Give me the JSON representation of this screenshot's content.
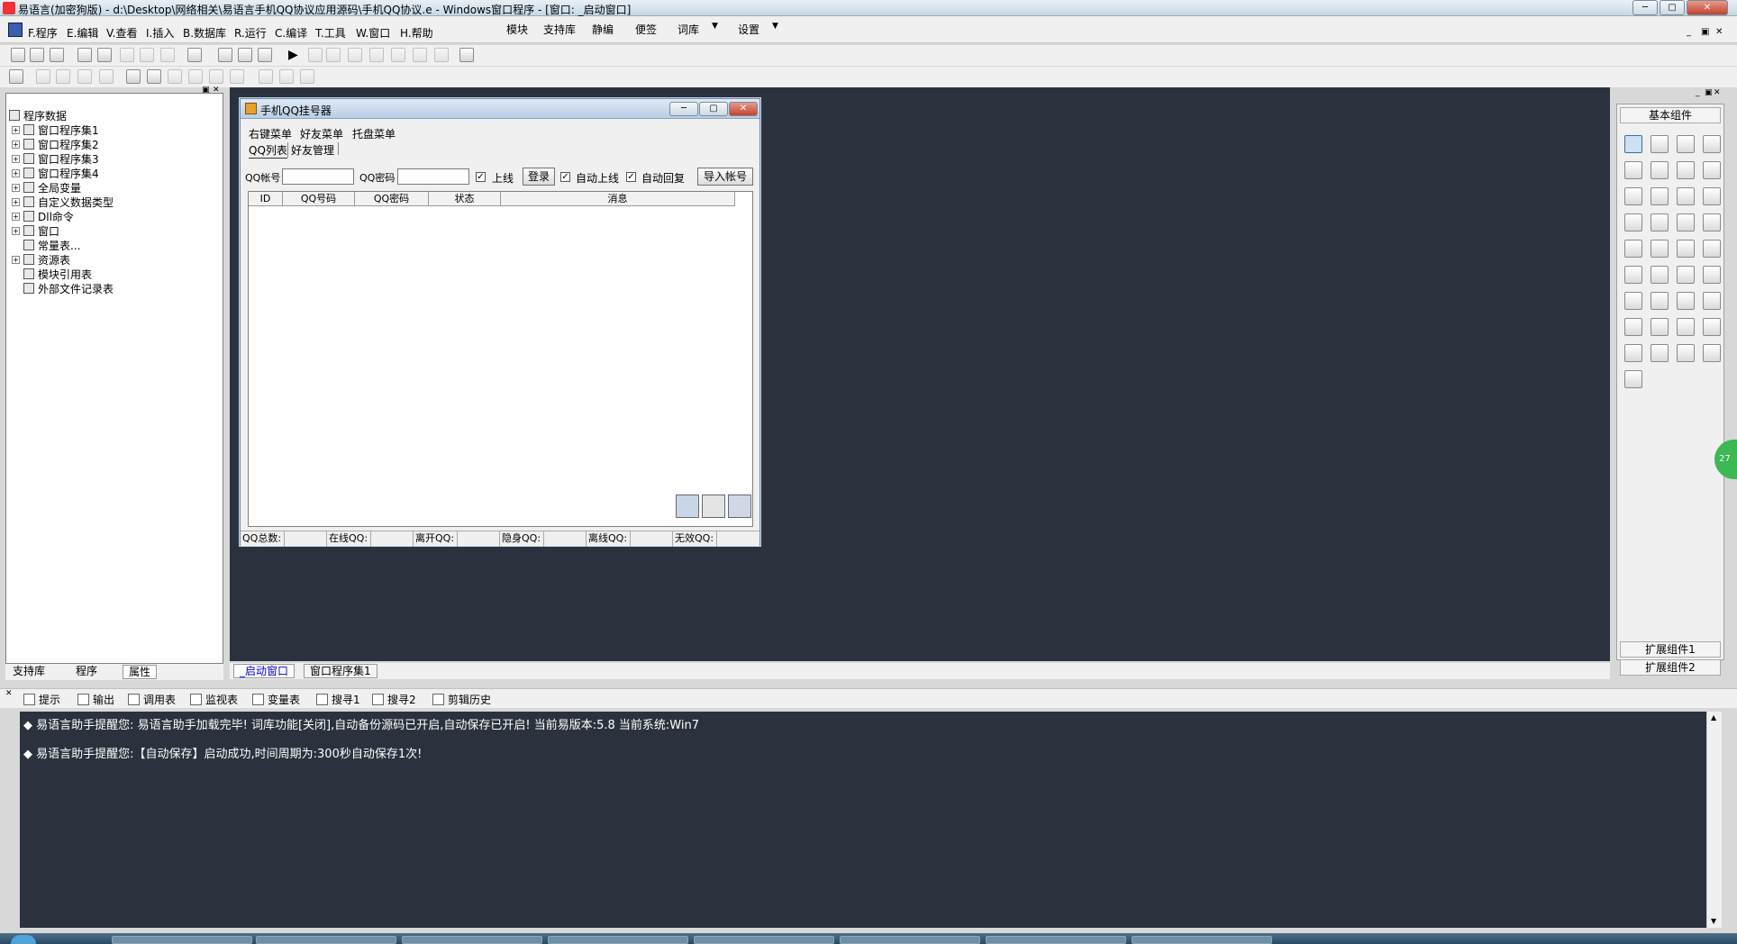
{
  "window": {
    "title": "易语言(加密狗版) - d:\\Desktop\\网络相关\\易语言手机QQ协议应用源码\\手机QQ协议.e - Windows窗口程序 - [窗口: _启动窗口]"
  },
  "menu": {
    "items": [
      "F.程序",
      "E.编辑",
      "V.查看",
      "I.插入",
      "B.数据库",
      "R.运行",
      "C.编译",
      "T.工具",
      "W.窗口",
      "H.帮助"
    ],
    "extra": [
      "模块",
      "支持库",
      "静编",
      "便签",
      "词库",
      "设置"
    ]
  },
  "tree": {
    "root": "程序数据",
    "items": [
      "窗口程序集1",
      "窗口程序集2",
      "窗口程序集3",
      "窗口程序集4",
      "全局变量",
      "自定义数据类型",
      "Dll命令",
      "窗口",
      "常量表...",
      "资源表",
      "模块引用表",
      "外部文件记录表"
    ]
  },
  "left_tabs": [
    "支持库",
    "程序",
    "属性"
  ],
  "design": {
    "title": "手机QQ挂号器",
    "menus": [
      "右键菜单",
      "好友菜单",
      "托盘菜单"
    ],
    "tabs": [
      "QQ列表",
      "好友管理"
    ],
    "qq_label": "QQ帐号",
    "pwd_label": "QQ密码",
    "online_label": "上线",
    "login_btn": "登录",
    "auto_online_label": "自动上线",
    "auto_reply_label": "自动回复",
    "import_btn": "导入帐号",
    "columns": [
      "ID",
      "QQ号码",
      "QQ密码",
      "状态",
      "消息"
    ],
    "status": [
      "QQ总数:",
      "在线QQ:",
      "离开QQ:",
      "隐身QQ:",
      "离线QQ:",
      "无效QQ:"
    ]
  },
  "components": {
    "header": "基本组件",
    "ext1": "扩展组件1",
    "ext2": "扩展组件2",
    "badge": "27"
  },
  "editor_tabs": [
    "_启动窗口",
    "窗口程序集1"
  ],
  "output_tabs": [
    "提示",
    "输出",
    "调用表",
    "监视表",
    "变量表",
    "搜寻1",
    "搜寻2",
    "剪辑历史"
  ],
  "output_lines": [
    "◆ 易语言助手提醒您:  易语言助手加载完毕!  词库功能[关闭],自动备份源码已开启,自动保存已开启!  当前易版本:5.8  当前系统:Win7",
    "◆ 易语言助手提醒您:【自动保存】启动成功,时间周期为:300秒自动保存1次!"
  ]
}
